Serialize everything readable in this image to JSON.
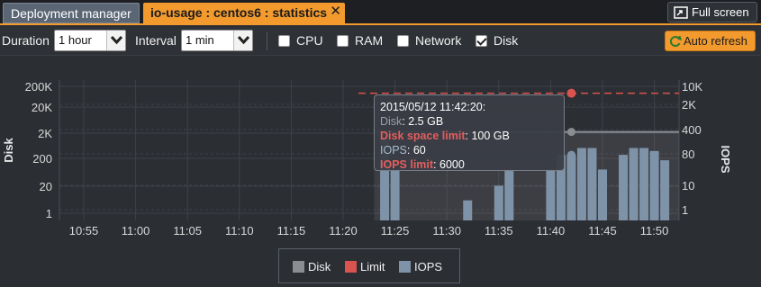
{
  "tabs": {
    "deployment": "Deployment manager",
    "active": "io-usage : centos6 : statistics",
    "close_glyph": "✕"
  },
  "fullscreen_label": "Full screen",
  "toolbar": {
    "duration_label": "Duration",
    "duration_value": "1 hour",
    "interval_label": "Interval",
    "interval_value": "1 min",
    "checkboxes": [
      {
        "label": "CPU",
        "checked": false
      },
      {
        "label": "RAM",
        "checked": false
      },
      {
        "label": "Network",
        "checked": false
      },
      {
        "label": "Disk",
        "checked": true
      }
    ],
    "auto_refresh": "Auto refresh"
  },
  "tooltip": {
    "timestamp": "2015/05/12 11:42:20:",
    "disk_label": "Disk",
    "disk_value": ": 2.5 GB",
    "disk_limit_label": "Disk space limit",
    "disk_limit_value": ": 100 GB",
    "iops_label": "IOPS",
    "iops_value": ": 60",
    "iops_limit_label": "IOPS limit",
    "iops_limit_value": ": 6000"
  },
  "colors": {
    "disk": "#8a8d91",
    "limit": "#d9534f",
    "iops": "#7f93a8",
    "accent": "#f29a2e"
  },
  "chart_data": {
    "type": "bar",
    "left_axis_title": "Disk",
    "right_axis_title": "IOPS",
    "left_ticks": [
      "200K",
      "20K",
      "2K",
      "200",
      "20",
      "1"
    ],
    "right_ticks": [
      "10K",
      "2K",
      "400",
      "80",
      "10",
      "1"
    ],
    "x_ticks": [
      "10:55",
      "11:00",
      "11:05",
      "11:10",
      "11:15",
      "11:20",
      "11:25",
      "11:30",
      "11:35",
      "11:40",
      "11:45",
      "11:50"
    ],
    "legend": [
      {
        "label": "Disk"
      },
      {
        "label": "Limit"
      },
      {
        "label": "IOPS"
      }
    ],
    "iops_limit": 6000,
    "disk_limit_mb": 100000,
    "disk_mb": 2500,
    "iops_series": [
      {
        "time": "11:24",
        "value": 200
      },
      {
        "time": "11:25",
        "value": 20
      },
      {
        "time": "11:32",
        "value": 2
      },
      {
        "time": "11:35",
        "value": 6
      },
      {
        "time": "11:36",
        "value": 20
      },
      {
        "time": "11:40",
        "value": 20
      },
      {
        "time": "11:41",
        "value": 60
      },
      {
        "time": "11:42",
        "value": 60
      },
      {
        "time": "11:43",
        "value": 100
      },
      {
        "time": "11:44",
        "value": 100
      },
      {
        "time": "11:45",
        "value": 20
      },
      {
        "time": "11:47",
        "value": 60
      },
      {
        "time": "11:48",
        "value": 100
      },
      {
        "time": "11:49",
        "value": 100
      },
      {
        "time": "11:50",
        "value": 80
      },
      {
        "time": "11:51",
        "value": 40
      }
    ]
  }
}
